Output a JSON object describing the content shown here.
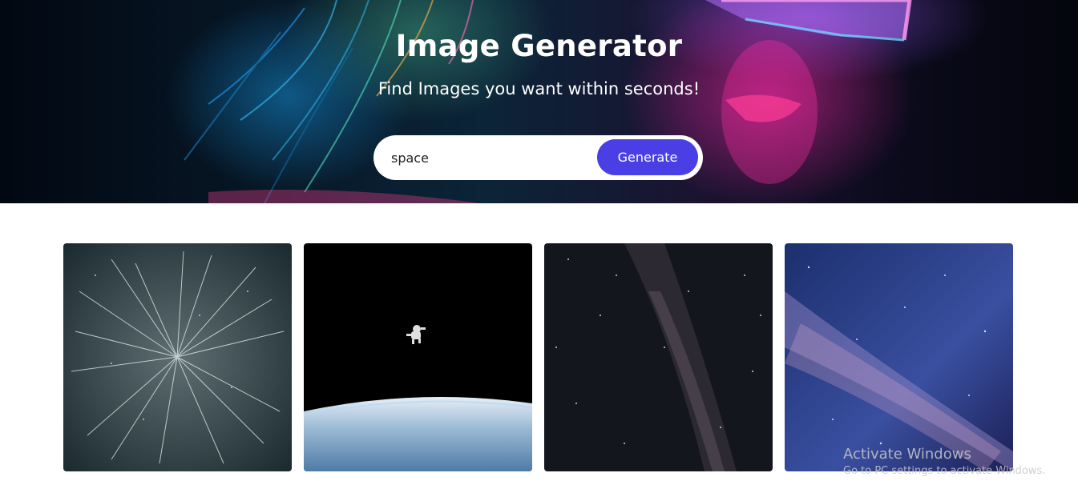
{
  "hero": {
    "title": "Image Generator",
    "subtitle": "Find Images you want within seconds!"
  },
  "search": {
    "value": "space",
    "button_label": "Generate"
  },
  "gallery": {
    "images": [
      {
        "subject": "star-streaks-hyperspace"
      },
      {
        "subject": "astronaut-floating-above-earth"
      },
      {
        "subject": "night-sky-milky-way-dark"
      },
      {
        "subject": "milky-way-blue-purple"
      }
    ]
  },
  "watermark": {
    "title": "Activate Windows",
    "subtitle": "Go to PC settings to activate Windows."
  },
  "colors": {
    "accent": "#4a3fe4",
    "hero_bg": "#071726",
    "page_bg": "#ffffff"
  }
}
